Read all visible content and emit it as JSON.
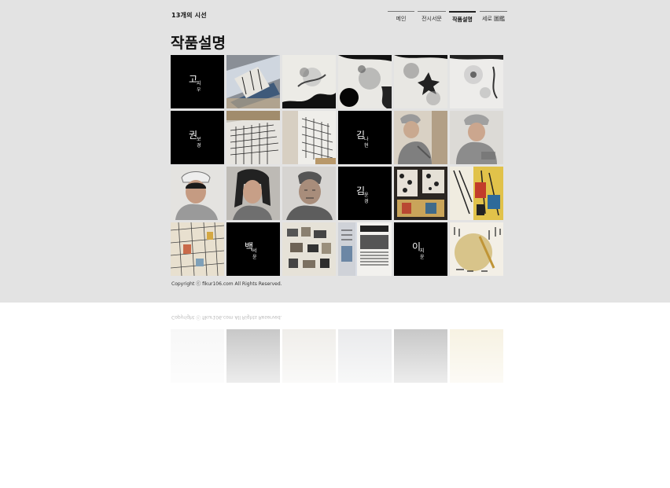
{
  "site": {
    "title": "13개의 시선"
  },
  "nav": {
    "items": [
      {
        "label": "메인",
        "active": false
      },
      {
        "label": "전시서문",
        "active": false
      },
      {
        "label": "작품설명",
        "active": true
      },
      {
        "label": "세로 圖鑑",
        "active": false
      }
    ]
  },
  "page": {
    "heading": "작품설명"
  },
  "artists": [
    {
      "surname": "고",
      "given": "지우"
    },
    {
      "surname": "권",
      "given": "보경"
    },
    {
      "surname": "김",
      "given": "나현"
    },
    {
      "surname": "김",
      "given": "윤경"
    },
    {
      "surname": "백",
      "given": "서윤"
    },
    {
      "surname": "이",
      "given": "지윤"
    }
  ],
  "artworks": [
    {
      "name": "artwork-ink-landscape-blue"
    },
    {
      "name": "artwork-ink-wash-black"
    },
    {
      "name": "artwork-ink-circles"
    },
    {
      "name": "artwork-ink-flower"
    },
    {
      "name": "artwork-ink-pale-flower"
    },
    {
      "name": "artwork-city-drawing"
    },
    {
      "name": "artwork-city-drawing-detail"
    },
    {
      "name": "artwork-worker-portrait-1"
    },
    {
      "name": "artwork-worker-portrait-2"
    },
    {
      "name": "artwork-woman-portrait-1"
    },
    {
      "name": "artwork-woman-portrait-2"
    },
    {
      "name": "artwork-man-portrait"
    },
    {
      "name": "artwork-pattern-collage-1"
    },
    {
      "name": "artwork-pattern-collage-2"
    },
    {
      "name": "artwork-building-collage"
    },
    {
      "name": "artwork-photo-installation"
    },
    {
      "name": "artwork-newspaper-collage"
    },
    {
      "name": "artwork-calligraphy-moon"
    }
  ],
  "footer": {
    "copyright": "Copyright ⓒ fikur106.com All Rights Reserved."
  }
}
